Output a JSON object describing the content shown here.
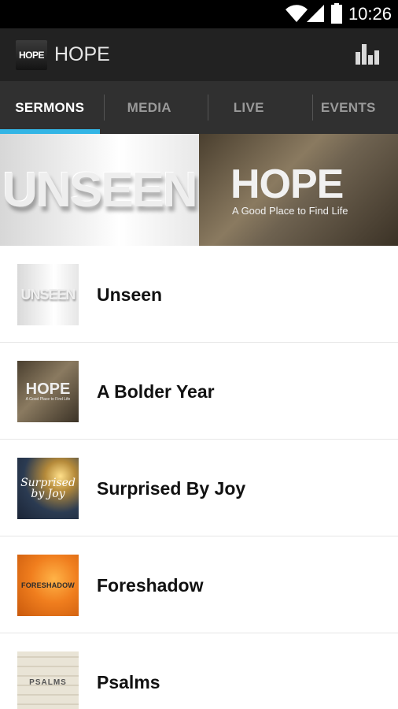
{
  "status_bar": {
    "time": "10:26"
  },
  "action_bar": {
    "logo_text": "HOPE",
    "title": "HOPE"
  },
  "tabs": [
    {
      "label": "SERMONS",
      "active": true
    },
    {
      "label": "MEDIA",
      "active": false
    },
    {
      "label": "LIVE",
      "active": false
    },
    {
      "label": "EVENTS",
      "active": false
    }
  ],
  "accent_color": "#33b5e5",
  "banners": {
    "left": {
      "text": "UNSEEN"
    },
    "right": {
      "title": "HOPE",
      "subtitle": "A Good Place to Find Life"
    }
  },
  "sermons": [
    {
      "title": "Unseen",
      "thumb_text": "UNSEEN"
    },
    {
      "title": "A Bolder Year",
      "thumb_text": "HOPE",
      "thumb_subtext": "A Good Place to Find Life"
    },
    {
      "title": "Surprised By Joy",
      "thumb_text": "Surprised by Joy"
    },
    {
      "title": "Foreshadow",
      "thumb_text": "FORESHADOW"
    },
    {
      "title": "Psalms",
      "thumb_text": "PSALMS"
    }
  ]
}
